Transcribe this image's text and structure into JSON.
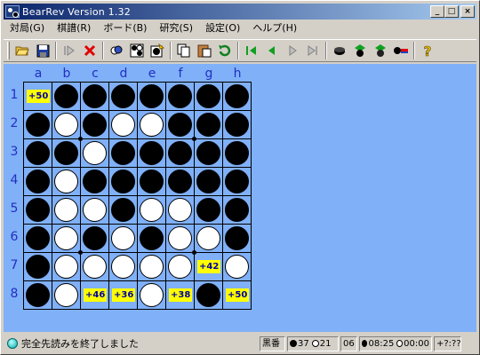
{
  "window": {
    "title": "BearRev Version 1.32",
    "controls": {
      "minimize": "_",
      "maximize": "□",
      "close": "×"
    }
  },
  "menu": [
    {
      "label": "対局(G)",
      "name": "menu-game"
    },
    {
      "label": "棋譜(R)",
      "name": "menu-record"
    },
    {
      "label": "ボード(B)",
      "name": "menu-board"
    },
    {
      "label": "研究(S)",
      "name": "menu-study"
    },
    {
      "label": "設定(O)",
      "name": "menu-settings"
    },
    {
      "label": "ヘルプ(H)",
      "name": "menu-help"
    }
  ],
  "toolbar_icons": [
    "open-folder-icon",
    "save-disk-icon",
    "play-icon",
    "stop-x-icon",
    "analyze-icon",
    "board-edit-icon",
    "hint-icon",
    "copy-icon",
    "paste-icon",
    "undo-icon",
    "first-move-icon",
    "prev-move-icon",
    "next-move-icon",
    "last-move-icon",
    "black-disc-icon",
    "black-cpu-icon",
    "white-cpu-icon",
    "level-icon",
    "help-icon"
  ],
  "board": {
    "columns": [
      "a",
      "b",
      "c",
      "d",
      "e",
      "f",
      "g",
      "h"
    ],
    "rows": [
      "1",
      "2",
      "3",
      "4",
      "5",
      "6",
      "7",
      "8"
    ],
    "cells": [
      [
        "+50",
        "B",
        "B",
        "B",
        "B",
        "B",
        "B",
        "B"
      ],
      [
        "B",
        "W",
        "B",
        "W",
        "W",
        "B",
        "B",
        "B"
      ],
      [
        "B",
        "B",
        "W",
        "B",
        "B",
        "B",
        "B",
        "B"
      ],
      [
        "B",
        "W",
        "B",
        "B",
        "B",
        "B",
        "B",
        "B"
      ],
      [
        "B",
        "W",
        "W",
        "B",
        "W",
        "W",
        "B",
        "B"
      ],
      [
        "B",
        "W",
        "B",
        "W",
        "B",
        "W",
        "W",
        "B"
      ],
      [
        "B",
        "W",
        "W",
        "W",
        "W",
        "W",
        "+42",
        "W"
      ],
      [
        "B",
        "W",
        "+46",
        "+36",
        "W",
        "+38",
        "B",
        "+50"
      ]
    ]
  },
  "status": {
    "message": "完全先読みを終了しました",
    "turn": "黒番",
    "black_count": "37",
    "white_count": "21",
    "move_number": "06",
    "black_time": "08:25",
    "white_time": "00:00",
    "eval": "+?:??"
  },
  "colors": {
    "board_bg": "#80b0f8",
    "label_color": "#2030c0",
    "eval_bg": "#ffff00",
    "title_left": "#0a246a"
  }
}
